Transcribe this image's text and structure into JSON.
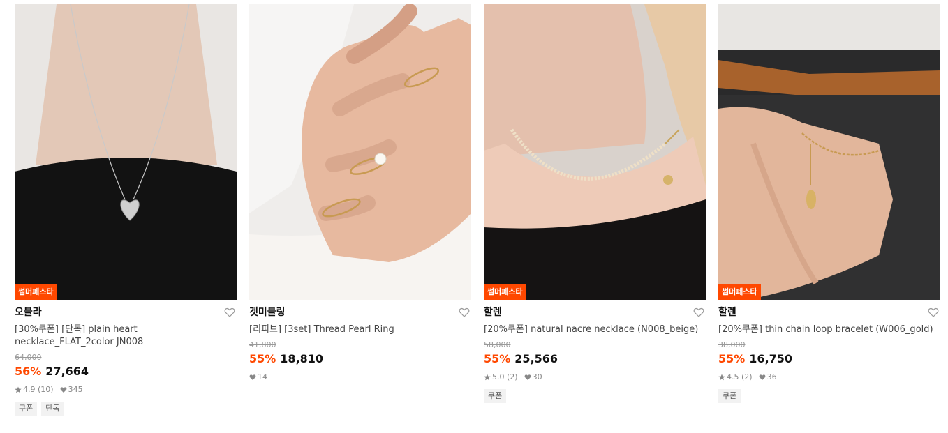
{
  "products": [
    {
      "image": "silver-heart-necklace-photo",
      "badge": "썸머페스타",
      "brand": "오블라",
      "title": "[30%쿠폰] [단독] plain heart necklace_FLAT_2color JN008",
      "original_price": "64,000",
      "discount_rate": "56%",
      "price": "27,664",
      "rating": "4.9 (10)",
      "likes": "345",
      "tags": [
        "쿠폰",
        "단독"
      ]
    },
    {
      "image": "pearl-ring-set-photo",
      "badge": "",
      "brand": "겟미블링",
      "title": "[리피브] [3set] Thread Pearl Ring",
      "original_price": "41,800",
      "discount_rate": "55%",
      "price": "18,810",
      "rating": "",
      "likes": "14",
      "tags": []
    },
    {
      "image": "nacre-bead-necklace-photo",
      "badge": "썸머페스타",
      "brand": "할렌",
      "title": "[20%쿠폰] natural nacre necklace (N008_beige)",
      "original_price": "58,000",
      "discount_rate": "55%",
      "price": "25,566",
      "rating": "5.0 (2)",
      "likes": "30",
      "tags": [
        "쿠폰"
      ]
    },
    {
      "image": "gold-chain-bracelet-photo",
      "badge": "썸머페스타",
      "brand": "할렌",
      "title": "[20%쿠폰] thin chain loop bracelet (W006_gold)",
      "original_price": "38,000",
      "discount_rate": "55%",
      "price": "16,750",
      "rating": "4.5 (2)",
      "likes": "36",
      "tags": [
        "쿠폰"
      ]
    }
  ],
  "colors": {
    "accent": "#ff4800",
    "text": "#111111",
    "muted": "#999999",
    "tag_bg": "#f2f2f2"
  }
}
